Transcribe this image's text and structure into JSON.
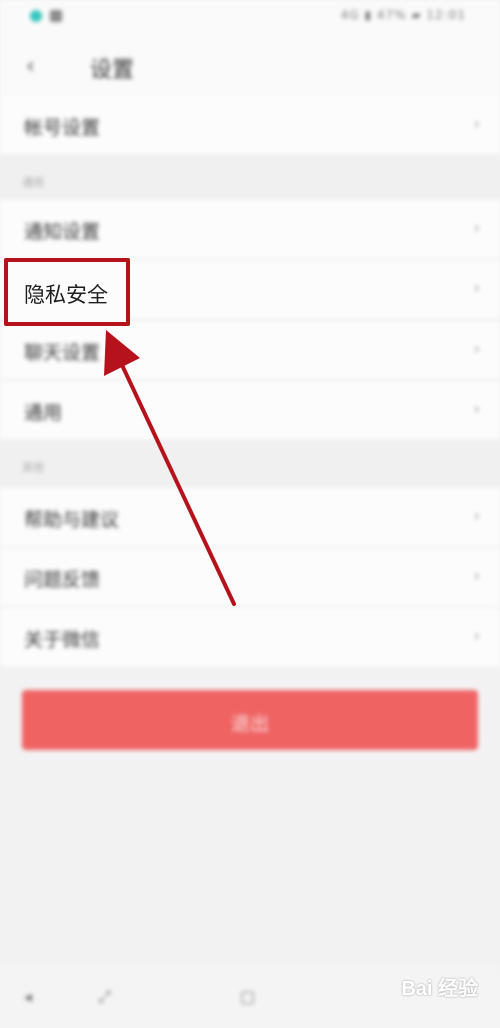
{
  "status_bar": {
    "right_text": "4G ▮ 47% ▰ 12:01"
  },
  "nav": {
    "back_icon": "chevron-left-icon",
    "back_glyph": "‹",
    "title": "设置"
  },
  "rows": {
    "account": "帐号设置",
    "notify": "通知设置",
    "privacy": "隐私安全",
    "general": "聊天设置",
    "clear": "通用"
  },
  "sections": {
    "general_caption": "通用",
    "other_caption": "其他"
  },
  "other_rows": {
    "help": "帮助与建议",
    "feedback": "问题反馈",
    "about": "关于微信"
  },
  "chevron_glyph": "›",
  "logout": {
    "label": "退出"
  },
  "bottom_bar": {
    "b1": "◂",
    "b2": "⤢",
    "b3": "▢"
  },
  "watermark": {
    "text": "Bai 经验"
  },
  "highlight": {
    "label": "隐私安全",
    "color": "#b5121b"
  },
  "accent": {
    "logout_bg": "#ef6363"
  }
}
